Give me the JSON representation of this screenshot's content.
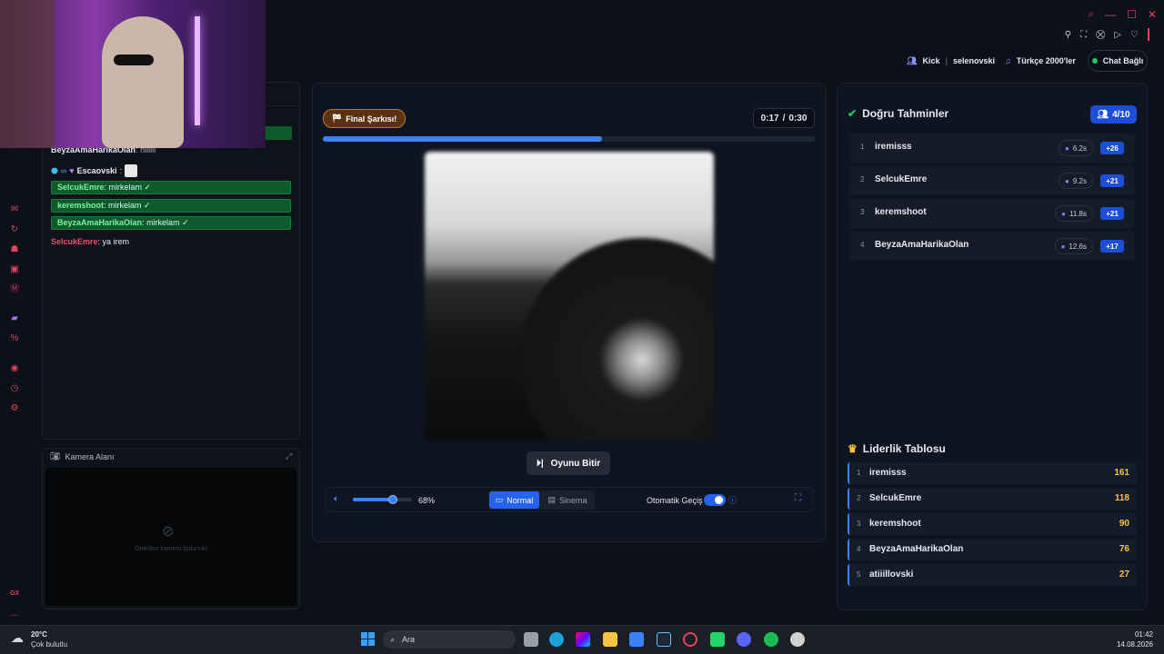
{
  "header": {
    "platform": "Kick",
    "channel": "selenovski",
    "playlist": "Türkçe 2000'ler",
    "chat_status": "Chat Bağlı"
  },
  "chat": {
    "partial_line_user": "BeyzaAmaHarikaOlan",
    "partial_line_text": "hiiiiii",
    "esca_user": "Escaovski",
    "messages": [
      {
        "user": "SelcukEmre",
        "text": "mirkelam ✓"
      },
      {
        "user": "keremshoot",
        "text": "mirkelam ✓"
      },
      {
        "user": "BeyzaAmaHarikaOlan",
        "text": "mirkelam ✓"
      }
    ],
    "last_user": "SelcukEmre",
    "last_text": "ya irem"
  },
  "camera": {
    "title": "Kamera Alanı",
    "empty_text": "Önerilen kamera bulunulu"
  },
  "player": {
    "badge": "Final Şarkısı!",
    "time_current": "0:17",
    "time_sep": "/",
    "time_total": "0:30",
    "progress_fraction": 0.5667,
    "end_button": "Oyunu Bitir",
    "volume_percent": 68,
    "volume_label": "68%",
    "mode_normal": "Normal",
    "mode_sinema": "Sinema",
    "auto_label": "Otomatik Geçiş",
    "auto_on": true
  },
  "guesses": {
    "title": "Doğru Tahminler",
    "count": "4/10",
    "rows": [
      {
        "rank": "1",
        "name": "iremisss",
        "time": "6.2s",
        "points": "+26"
      },
      {
        "rank": "2",
        "name": "SelcukEmre",
        "time": "9.2s",
        "points": "+21"
      },
      {
        "rank": "3",
        "name": "keremshoot",
        "time": "11.8s",
        "points": "+21"
      },
      {
        "rank": "4",
        "name": "BeyzaAmaHarikaOlan",
        "time": "12.6s",
        "points": "+17"
      }
    ]
  },
  "leaderboard": {
    "title": "Liderlik Tablosu",
    "rows": [
      {
        "rank": "1",
        "name": "iremisss",
        "score": "161"
      },
      {
        "rank": "2",
        "name": "SelcukEmre",
        "score": "118"
      },
      {
        "rank": "3",
        "name": "keremshoot",
        "score": "90"
      },
      {
        "rank": "4",
        "name": "BeyzaAmaHarikaOlan",
        "score": "76"
      },
      {
        "rank": "5",
        "name": "atiiillovski",
        "score": "27"
      }
    ]
  },
  "taskbar": {
    "weather_temp": "20°C",
    "weather_text": "Çok bulutlu",
    "search_placeholder": "Ara",
    "time": "01:42",
    "date": "14.08.2026",
    "rail_label": "GX"
  },
  "colors": {
    "accent_blue": "#3b82f6",
    "success_green": "#22c55e",
    "gold": "#f5c542",
    "opera_red": "#e0455b"
  }
}
